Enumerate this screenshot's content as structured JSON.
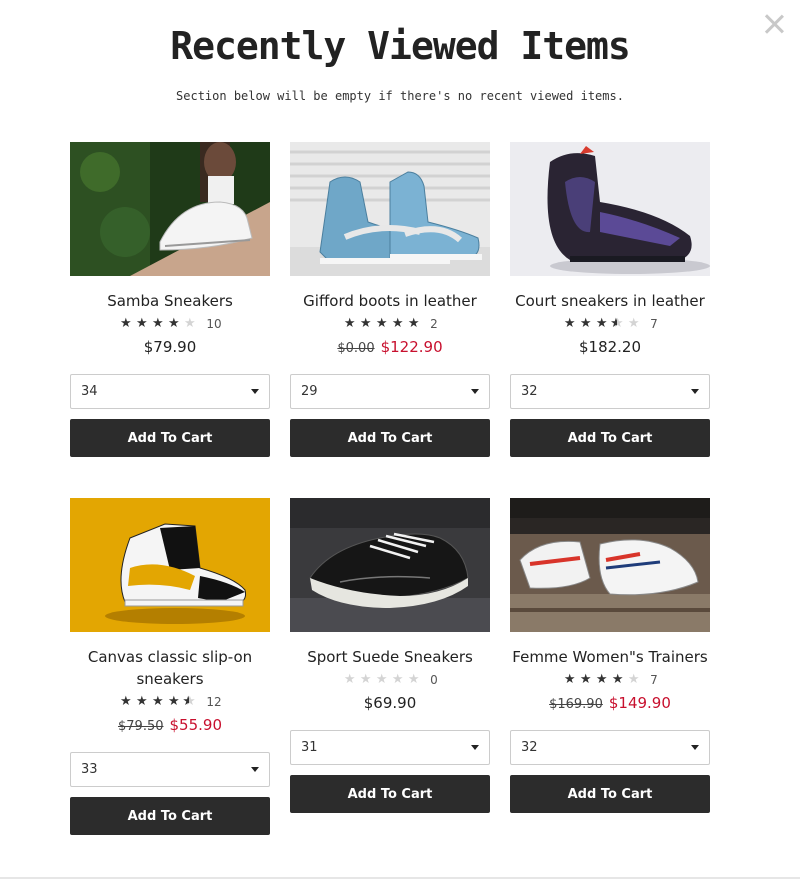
{
  "modal": {
    "title": "Recently Viewed Items",
    "subtitle": "Section below will be empty if there's no recent viewed items.",
    "close_icon": "close-icon"
  },
  "products": [
    {
      "name": "Samba Sneakers",
      "rating": 4,
      "rating_count": "10",
      "price": "$79.90",
      "old_price": "",
      "size": "34",
      "button": "Add To Cart"
    },
    {
      "name": "Gifford boots in leather",
      "rating": 5,
      "rating_count": "2",
      "price": "$122.90",
      "old_price": "$0.00",
      "size": "29",
      "button": "Add To Cart"
    },
    {
      "name": "Court sneakers in leather",
      "rating": 3.5,
      "rating_count": "7",
      "price": "$182.20",
      "old_price": "",
      "size": "32",
      "button": "Add To Cart"
    },
    {
      "name": "Canvas classic slip-on sneakers",
      "rating": 4.5,
      "rating_count": "12",
      "price": "$55.90",
      "old_price": "$79.50",
      "size": "33",
      "button": "Add To Cart"
    },
    {
      "name": "Sport Suede Sneakers",
      "rating": 0,
      "rating_count": "0",
      "price": "$69.90",
      "old_price": "",
      "size": "31",
      "button": "Add To Cart"
    },
    {
      "name": "Femme Women\"s Trainers",
      "rating": 4,
      "rating_count": "7",
      "price": "$149.90",
      "old_price": "$169.90",
      "size": "32",
      "button": "Add To Cart"
    }
  ],
  "colors": {
    "sale": "#c8102e",
    "button": "#2c2c2c",
    "star": "#333333"
  }
}
